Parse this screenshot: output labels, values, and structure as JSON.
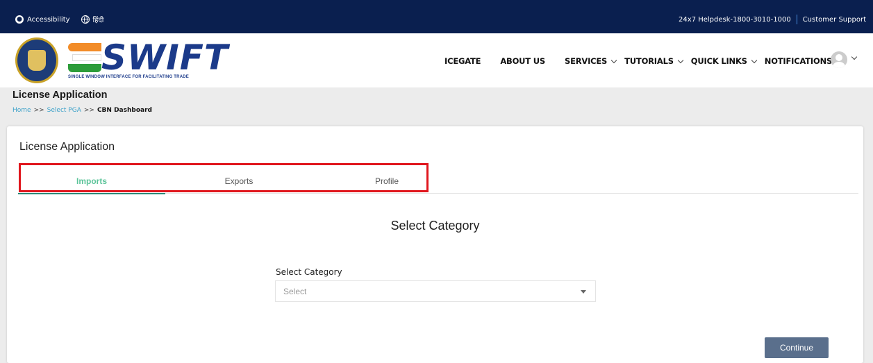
{
  "topbar": {
    "accessibility_label": "Accessibility",
    "language_label": "हिंदी",
    "helpdesk_label": "24x7 Helpdesk-1800-3010-1000",
    "support_label": "Customer Support"
  },
  "brand": {
    "wordmark": "SWIFT",
    "tagline": "SINGLE WINDOW INTERFACE FOR FACILITATING TRADE"
  },
  "nav": {
    "items": [
      {
        "label": "ICEGATE"
      },
      {
        "label": "ABOUT US"
      },
      {
        "label": "SERVICES"
      },
      {
        "label": "TUTORIALS"
      },
      {
        "label": "QUICK LINKS"
      },
      {
        "label": "NOTIFICATIONS"
      }
    ]
  },
  "page": {
    "title": "License Application",
    "breadcrumb": {
      "home": "Home",
      "sep": ">>",
      "select_pga": "Select PGA",
      "current": "CBN Dashboard"
    }
  },
  "card": {
    "title": "License Application",
    "tabs": [
      {
        "label": "Imports",
        "active": true
      },
      {
        "label": "Exports",
        "active": false
      },
      {
        "label": "Profile",
        "active": false
      }
    ],
    "section_title": "Select Category",
    "field_label": "Select Category",
    "select_value": "Select",
    "continue_label": "Continue"
  },
  "colors": {
    "topbar_bg": "#0a1f4f",
    "active_tab": "#5cc49a",
    "highlight_border": "#e0161d",
    "continue_bg": "#5a6f8c",
    "breadcrumb_link": "#3aa0c8"
  }
}
